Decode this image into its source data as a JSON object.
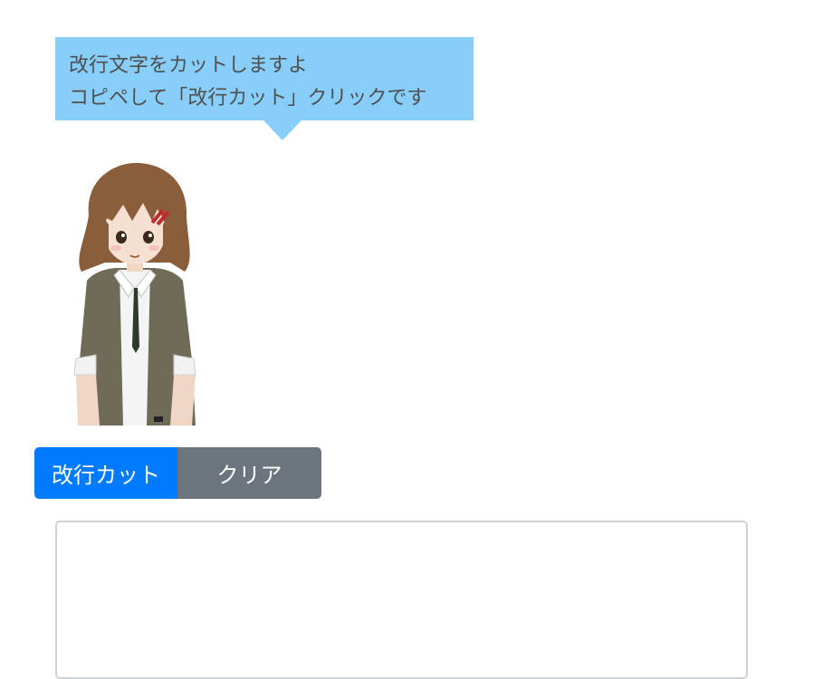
{
  "bubble": {
    "line1": "改行文字をカットしますよ",
    "line2": "コピペして「改行カット」クリックです"
  },
  "character": {
    "icon": "anime-girl-mascot-illustration"
  },
  "buttons": {
    "cut_label": "改行カット",
    "clear_label": "クリア"
  },
  "input": {
    "value": "",
    "placeholder": ""
  },
  "colors": {
    "bubble": "#87cefa",
    "primary": "#007bff",
    "secondary": "#6c757d",
    "bubble_text": "#4f4f4f"
  }
}
